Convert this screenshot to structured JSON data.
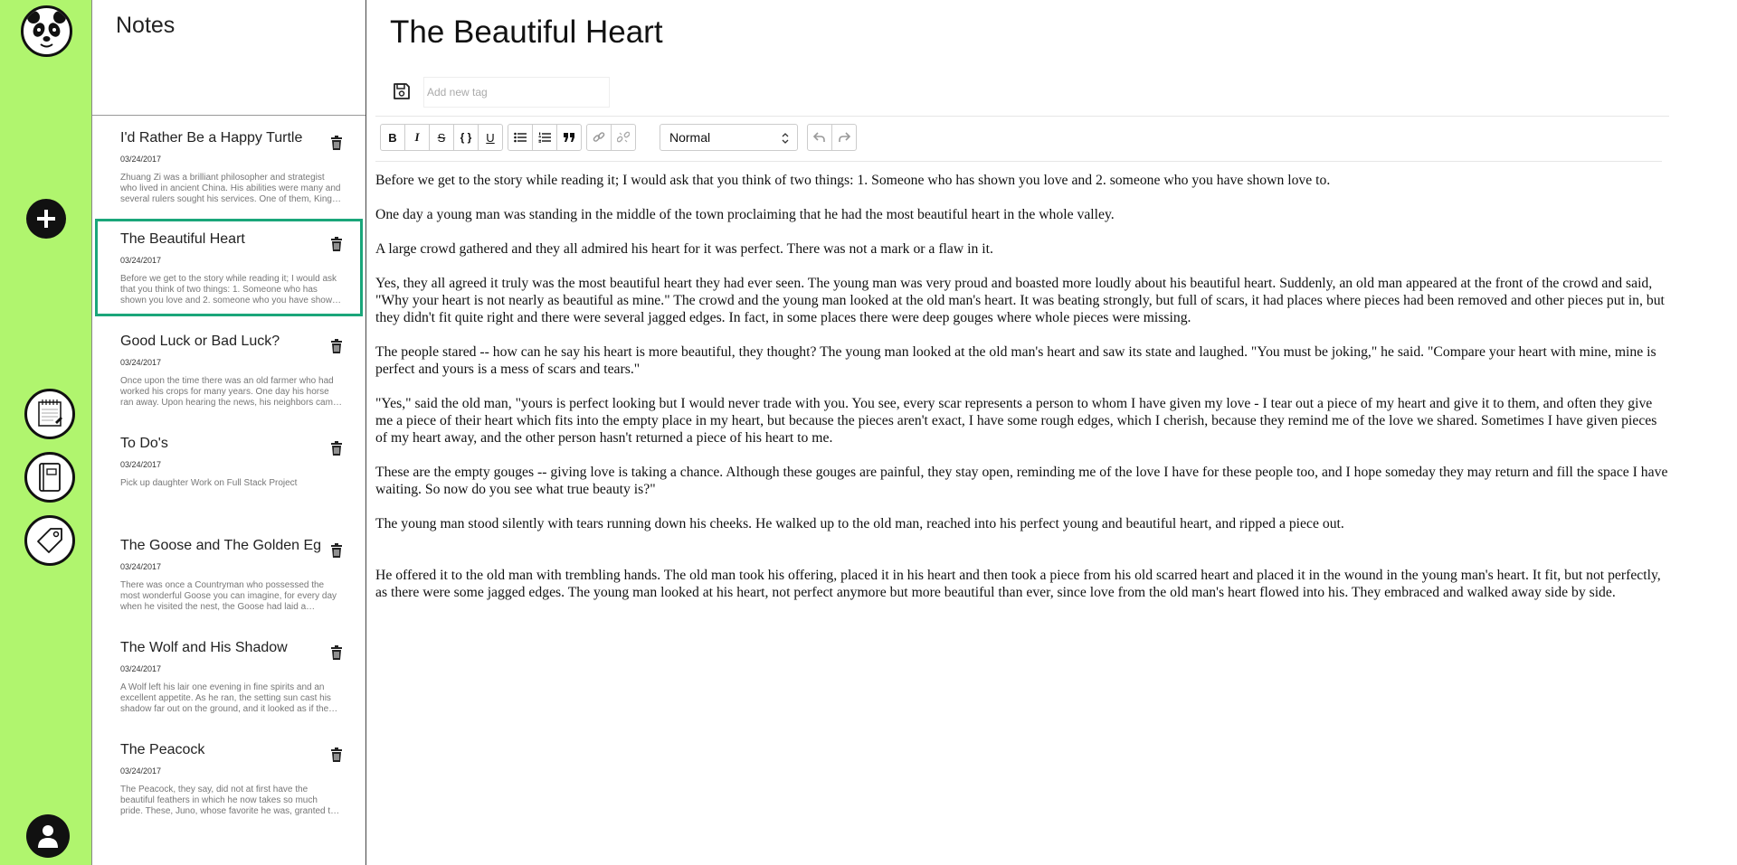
{
  "rail": {
    "logo": "panda-logo",
    "new_note_icon": "plus-icon",
    "buttons": [
      "notebook-icon",
      "book-icon",
      "tag-icon"
    ],
    "user_icon": "user-icon",
    "color": "#b0f56e"
  },
  "notes_panel": {
    "title": "Notes",
    "items": [
      {
        "title": "I'd Rather Be a Happy Turtle",
        "date": "03/24/2017",
        "preview": "Zhuang Zi was a brilliant philosopher and strategist who lived in ancient China. His abilities were many and several rulers sought his services. One of them, King…",
        "active": false
      },
      {
        "title": "The Beautiful Heart",
        "date": "03/24/2017",
        "preview": "Before we get to the story while reading it; I would ask that you think of two things: 1. Someone who has shown you love and 2. someone who you have show…",
        "active": true
      },
      {
        "title": "Good Luck or Bad Luck?",
        "date": "03/24/2017",
        "preview": "Once upon the time there was an old farmer who had worked his crops for many years. One day his horse ran away. Upon hearing the news, his neighbors cam…",
        "active": false
      },
      {
        "title": "To Do's",
        "date": "03/24/2017",
        "preview": "Pick up daughter Work on Full Stack Project",
        "active": false
      },
      {
        "title": "The Goose and The Golden Eg",
        "date": "03/24/2017",
        "preview": "There was once a Countryman who possessed the most wonderful Goose you can imagine, for every day when he visited the nest, the Goose had laid a…",
        "active": false
      },
      {
        "title": "The Wolf and His Shadow",
        "date": "03/24/2017",
        "preview": "A Wolf left his lair one evening in fine spirits and an excellent appetite. As he ran, the setting sun cast his shadow far out on the ground, and it looked as if the…",
        "active": false
      },
      {
        "title": "The Peacock",
        "date": "03/24/2017",
        "preview": "The Peacock, they say, did not at first have the beautiful feathers in which he now takes so much pride. These, Juno, whose favorite he was, granted t…",
        "active": false
      }
    ],
    "active_color": "#1aa67a"
  },
  "editor": {
    "title": "The Beautiful Heart",
    "save_icon": "save-icon",
    "tag_placeholder": "Add new tag",
    "toolbar": {
      "bold": "B",
      "italic": "I",
      "strikethrough": "S",
      "code": "{ }",
      "underline": "U",
      "block_style": "Normal"
    },
    "paragraphs": [
      "Before we get to the story while reading it; I would ask that you think of two things: 1. Someone who has shown you love and 2. someone who you have shown love to.",
      "One day a young man was standing in the middle of the town proclaiming that he had the most beautiful heart in the whole valley.",
      "A large crowd gathered and they all admired his heart for it was perfect. There was not a mark or a flaw in it.",
      "Yes, they all agreed it truly was the most beautiful heart they had ever seen. The young man was very proud and boasted more loudly about his beautiful heart. Suddenly, an old man appeared at the front of the crowd and said, \"Why your heart is not nearly as beautiful as mine.\" The crowd and the young man looked at the old man's heart. It was beating strongly, but full of scars, it had places where pieces had been removed and other pieces put in, but they didn't fit quite right and there were several jagged edges.  In fact, in some places there were deep gouges where whole pieces were missing.",
      "The people stared -- how can he say his heart is more beautiful, they thought? The young man looked at the old man's heart and saw its state and laughed. \"You must be joking,\" he said. \"Compare your heart with mine, mine is perfect and yours is a mess of scars and tears.\"",
      "\"Yes,\" said the old man, \"yours is perfect looking but I would never trade with you. You see, every scar represents a person to whom I have given my love - I tear out a piece of my heart and give it to them, and often they give me a piece of their heart which fits into the empty place in my heart, but because the pieces aren't exact, I have some rough edges, which I cherish, because they remind me of the love we shared. Sometimes I have given pieces of my heart away, and the other person hasn't returned a piece of his heart to me.",
      "These are the empty gouges -- giving love is taking a chance. Although these gouges are painful, they stay open, reminding me of the love I have for these people too, and I hope someday they may return and fill the space I have waiting. So now do you see what true beauty is?\"",
      "The young man stood silently with tears running down his cheeks. He walked up to the old man, reached into his perfect young and beautiful heart, and ripped a piece out.",
      "He offered it to the old man with trembling hands. The old man took his offering, placed it in his heart and then took a piece from his old scarred heart and placed it in the wound in the young man's heart. It fit, but not perfectly, as there were some jagged edges. The young man looked at his heart, not perfect anymore but more beautiful than ever, since love from the old man's heart flowed into his. They embraced and walked away side by side."
    ]
  }
}
